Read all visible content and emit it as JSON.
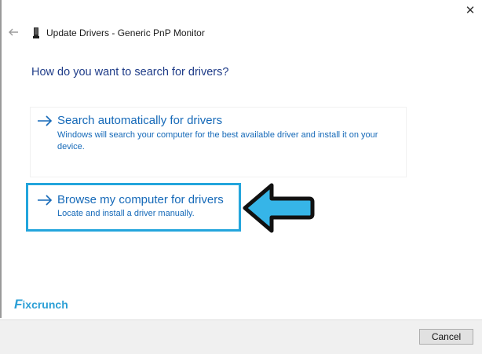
{
  "window": {
    "title": "Update Drivers - Generic PnP Monitor",
    "close_glyph": "✕",
    "back_glyph": "←"
  },
  "heading": "How do you want to search for drivers?",
  "options": [
    {
      "title": "Search automatically for drivers",
      "description": "Windows will search your computer for the best available driver and install it on your device.",
      "highlighted": false
    },
    {
      "title": "Browse my computer for drivers",
      "description": "Locate and install a driver manually.",
      "highlighted": true
    }
  ],
  "watermark": {
    "first": "F",
    "rest": "ixcrunch"
  },
  "footer": {
    "cancel_label": "Cancel"
  },
  "colors": {
    "link_blue": "#1569b8",
    "heading_blue": "#1f3c88",
    "highlight_border": "#23a5dc",
    "pointer_fill": "#36b5e8",
    "footer_bg": "#f0f0f0"
  },
  "icons": {
    "back": "back-arrow-icon",
    "monitor": "monitor-icon",
    "close": "close-icon",
    "option_arrow": "right-arrow-icon",
    "annotation": "pointer-arrow-icon"
  }
}
